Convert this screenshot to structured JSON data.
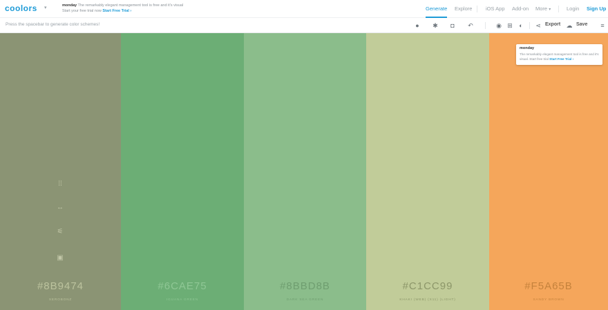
{
  "header": {
    "logo": "coolors",
    "promo": {
      "brand": "monday",
      "text": "The remarkably elegant management tool is free and it's visual",
      "line2": "Start your free trial now",
      "cta": "Start Free Trial ›"
    },
    "nav": {
      "generate": "Generate",
      "explore": "Explore",
      "ios_app": "iOS App",
      "add_on": "Add-on",
      "more": "More",
      "login": "Login",
      "signup": "Sign Up"
    }
  },
  "toolbar": {
    "hint": "Press the spacebar to generate color schemes!",
    "export_label": "Export",
    "save_label": "Save"
  },
  "palette": [
    {
      "hex": "#8B9474",
      "name": "Xerobonz",
      "color": "#8B9474",
      "text_color": "#bcc39e"
    },
    {
      "hex": "#6CAE75",
      "name": "Iguana Green",
      "color": "#6CAE75",
      "text_color": "#8fc795"
    },
    {
      "hex": "#8BBD8B",
      "name": "Dark Sea Green",
      "color": "#8BBD8B",
      "text_color": "#6f9e70"
    },
    {
      "hex": "#C1CC99",
      "name": "Khaki (Web) (X11) (Light)",
      "color": "#C1CC99",
      "text_color": "#8c9669"
    },
    {
      "hex": "#F5A65B",
      "name": "Sandy Brown",
      "color": "#F5A65B",
      "text_color": "#c5823c"
    }
  ],
  "popup": {
    "title": "monday",
    "text": "The remarkably elegant management tool is free and it's visual. Start free trial",
    "cta": "Start Free Trial ›"
  },
  "accent_color": "#1e9bd7"
}
